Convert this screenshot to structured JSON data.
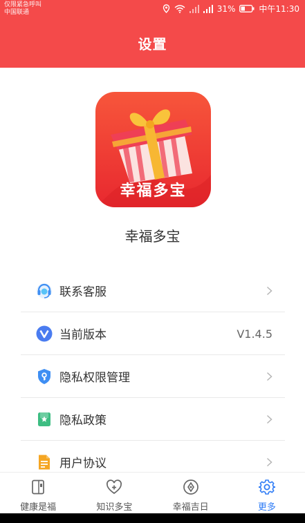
{
  "status_bar": {
    "carrier_line1": "仅限紧急呼叫",
    "carrier_line2": "中国联通",
    "battery": "31%",
    "time": "中午11:30"
  },
  "header": {
    "title": "设置"
  },
  "app": {
    "logo_text": "幸福多宝",
    "name": "幸福多宝"
  },
  "menu": [
    {
      "label": "联系客服",
      "icon": "headset-icon",
      "value": ""
    },
    {
      "label": "当前版本",
      "icon": "version-icon",
      "value": "V1.4.5"
    },
    {
      "label": "隐私权限管理",
      "icon": "shield-icon",
      "value": ""
    },
    {
      "label": "隐私政策",
      "icon": "bookmark-icon",
      "value": ""
    },
    {
      "label": "用户协议",
      "icon": "document-icon",
      "value": ""
    }
  ],
  "tabs": [
    {
      "label": "健康是福",
      "icon": "book-icon",
      "active": false
    },
    {
      "label": "知识多宝",
      "icon": "heart-plus-icon",
      "active": false
    },
    {
      "label": "幸福吉日",
      "icon": "compass-icon",
      "active": false
    },
    {
      "label": "更多",
      "icon": "gear-icon",
      "active": true
    }
  ],
  "colors": {
    "header": "#f44a4a",
    "accent": "#2f7cf6"
  }
}
